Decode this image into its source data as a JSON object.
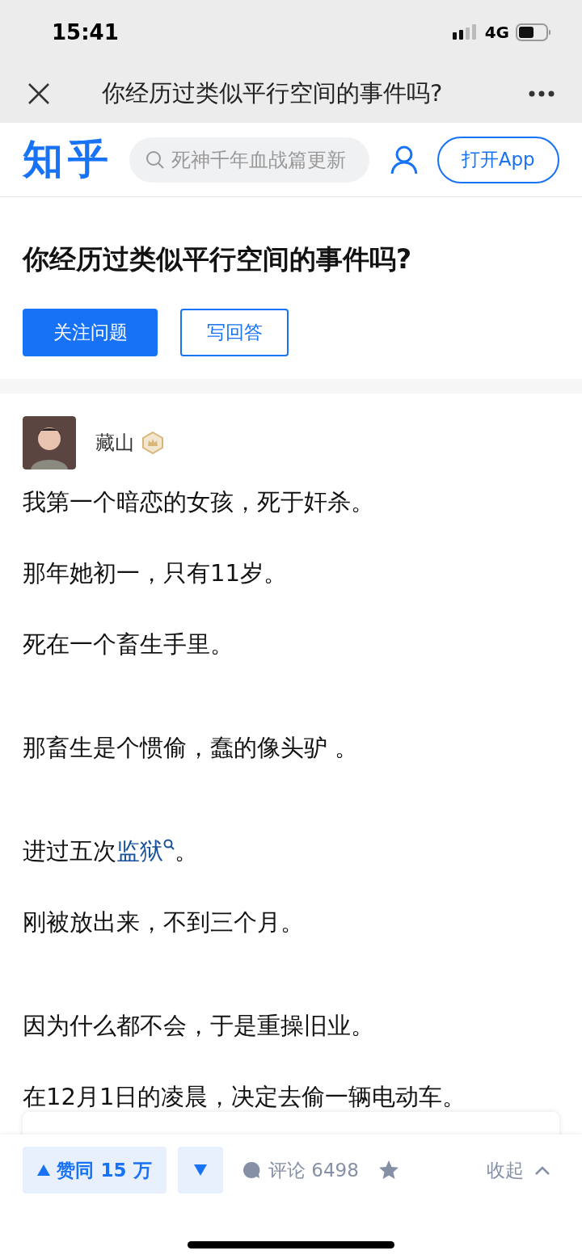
{
  "status_bar": {
    "time": "15:41",
    "network": "4G"
  },
  "browser_bar": {
    "title": "你经历过类似平行空间的事件吗?"
  },
  "header": {
    "logo": "知乎",
    "search_placeholder": "死神千年血战篇更新",
    "open_app": "打开App"
  },
  "question": {
    "title": "你经历过类似平行空间的事件吗?",
    "follow": "关注问题",
    "answer": "写回答"
  },
  "answer": {
    "author": "藏山",
    "sections": [
      {
        "paragraphs": [
          {
            "segments": [
              {
                "kind": "text",
                "text": "我第一个暗恋的女孩，死于奸杀。"
              }
            ]
          },
          {
            "segments": [
              {
                "kind": "text",
                "text": "那年她初一，只有11岁。"
              }
            ]
          },
          {
            "segments": [
              {
                "kind": "text",
                "text": "死在一个畜生手里。"
              }
            ]
          }
        ]
      },
      {
        "paragraphs": [
          {
            "segments": [
              {
                "kind": "text",
                "text": "那畜生是个惯偷，蠢的像头驴 。"
              }
            ]
          }
        ]
      },
      {
        "paragraphs": [
          {
            "segments": [
              {
                "kind": "text",
                "text": "进过五次"
              },
              {
                "kind": "link",
                "text": "监狱"
              },
              {
                "kind": "text",
                "text": "。"
              }
            ]
          },
          {
            "segments": [
              {
                "kind": "text",
                "text": "刚被放出来，不到三个月。"
              }
            ]
          }
        ]
      },
      {
        "paragraphs": [
          {
            "segments": [
              {
                "kind": "text",
                "text": "因为什么都不会，于是重操旧业。"
              }
            ]
          },
          {
            "segments": [
              {
                "kind": "text",
                "text": "在12月1日的凌晨，决定去偷一辆电动车。"
              }
            ]
          }
        ]
      }
    ]
  },
  "action_bar": {
    "upvote": "赞同 15 万",
    "comments": "评论 6498",
    "collapse": "收起"
  }
}
